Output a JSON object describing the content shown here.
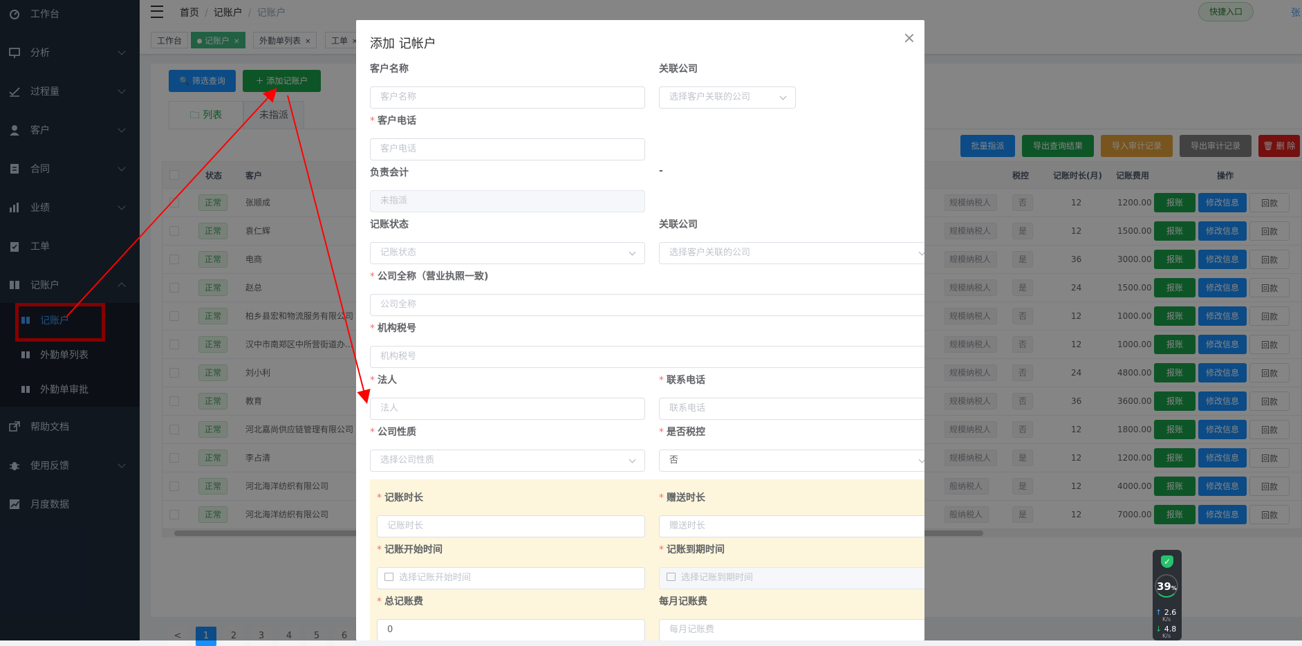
{
  "sidebar": {
    "items": [
      {
        "label": "工作台",
        "icon": "dashboard-icon"
      },
      {
        "label": "分析",
        "icon": "chart-icon"
      },
      {
        "label": "过程量",
        "icon": "process-icon"
      },
      {
        "label": "客户",
        "icon": "user-icon"
      },
      {
        "label": "合同",
        "icon": "contract-icon"
      },
      {
        "label": "业绩",
        "icon": "bar-chart-icon"
      },
      {
        "label": "工单",
        "icon": "clipboard-icon"
      },
      {
        "label": "记账户",
        "icon": "book-icon"
      },
      {
        "label": "帮助文档",
        "icon": "external-link-icon"
      },
      {
        "label": "使用反馈",
        "icon": "bug-icon"
      },
      {
        "label": "月度数据",
        "icon": "trend-icon"
      }
    ],
    "subitems": [
      "记账户",
      "外勤单列表",
      "外勤单审批"
    ]
  },
  "topbar": {
    "breadcrumb": [
      "首页",
      "记账户",
      "记账户"
    ],
    "quick_entry": "快捷入口",
    "username": "张"
  },
  "tags": [
    {
      "label": "工作台"
    },
    {
      "label": "记账户"
    },
    {
      "label": "外勤单列表"
    },
    {
      "label": "工单"
    }
  ],
  "toolbar": {
    "filter": "筛选查询",
    "add": "添加记账户",
    "batch_assign": "批量指派",
    "export_result": "导出查询结果",
    "import_audit": "导入审计记录",
    "export_audit": "导出审计记录",
    "delete": "删 除"
  },
  "tabs": [
    "列表",
    "未指派"
  ],
  "table": {
    "headers": {
      "status": "状态",
      "customer": "客户",
      "tax_control": "税控",
      "duration": "记账时长(月)",
      "fee": "记账费用",
      "actions": "操作"
    },
    "rows": [
      {
        "status": "正常",
        "customer": "张顺成",
        "taxpayer": "规模纳税人",
        "tax": "否",
        "months": "12",
        "fee": "1200.00"
      },
      {
        "status": "正常",
        "customer": "袁仁辉",
        "taxpayer": "规模纳税人",
        "tax": "是",
        "months": "12",
        "fee": "1500.00"
      },
      {
        "status": "正常",
        "customer": "电商",
        "taxpayer": "规模纳税人",
        "tax": "是",
        "months": "36",
        "fee": "3000.00"
      },
      {
        "status": "正常",
        "customer": "赵总",
        "taxpayer": "规模纳税人",
        "tax": "是",
        "months": "24",
        "fee": "1500.00"
      },
      {
        "status": "正常",
        "customer": "柏乡县宏和物流服务有限公司",
        "taxpayer": "规模纳税人",
        "tax": "否",
        "months": "12",
        "fee": "1000.00"
      },
      {
        "status": "正常",
        "customer": "汉中市南郑区中所营街道办...",
        "taxpayer": "规模纳税人",
        "tax": "否",
        "months": "12",
        "fee": "1000.00"
      },
      {
        "status": "正常",
        "customer": "刘小利",
        "taxpayer": "规模纳税人",
        "tax": "否",
        "months": "24",
        "fee": "4800.00"
      },
      {
        "status": "正常",
        "customer": "教育",
        "taxpayer": "规模纳税人",
        "tax": "否",
        "months": "36",
        "fee": "3600.00"
      },
      {
        "status": "正常",
        "customer": "河北嘉尚供应链管理有限公司",
        "taxpayer": "规模纳税人",
        "tax": "否",
        "months": "12",
        "fee": "1800.00"
      },
      {
        "status": "正常",
        "customer": "李占清",
        "taxpayer": "规模纳税人",
        "tax": "是",
        "months": "12",
        "fee": "1200.00"
      },
      {
        "status": "正常",
        "customer": "河北海洋纺织有限公司",
        "taxpayer": "般纳税人",
        "tax": "是",
        "months": "12",
        "fee": "4000.00"
      },
      {
        "status": "正常",
        "customer": "河北海洋纺织有限公司",
        "taxpayer": "般纳税人",
        "tax": "是",
        "months": "12",
        "fee": "7000.00"
      }
    ],
    "actions": {
      "report": "报账",
      "edit": "修改信息",
      "refund": "回款"
    }
  },
  "pagination": [
    "<",
    "1",
    "2",
    "3",
    "4",
    "5",
    "6"
  ],
  "net_widget": {
    "percent": "39",
    "percent_unit": "%",
    "up": "2.6",
    "down": "4.8",
    "unit": "K/s"
  },
  "dialog": {
    "title": "添加 记帐户",
    "labels": {
      "customer_name": "客户名称",
      "linked_company_1": "关联公司",
      "customer_phone": "客户电话",
      "accountant": "负责会计",
      "dash": "-",
      "account_status": "记账状态",
      "linked_company_2": "关联公司",
      "company_full": "公司全称（营业执照一致)",
      "tax_no": "机构税号",
      "legal": "法人",
      "contact_phone": "联系电话",
      "company_nature": "公司性质",
      "tax_control": "是否税控",
      "duration": "记账时长",
      "gift_duration": "赠送时长",
      "start_time": "记账开始时间",
      "end_time": "记账到期时间",
      "total_fee": "总记账费",
      "monthly_fee": "每月记账费"
    },
    "placeholders": {
      "customer_name": "客户名称",
      "linked_company_1": "选择客户关联的公司",
      "customer_phone": "客户电话",
      "accountant": "未指派",
      "account_status": "记账状态",
      "linked_company_2": "选择客户关联的公司",
      "company_full": "公司全称",
      "tax_no": "机构税号",
      "legal": "法人",
      "contact_phone": "联系电话",
      "company_nature": "选择公司性质",
      "duration": "记账时长",
      "gift_duration": "赠送时长",
      "start_time": "选择记账开始时间",
      "end_time": "选择记账到期时间",
      "monthly_fee": "每月记账费"
    },
    "values": {
      "tax_control": "否",
      "total_fee": "0"
    }
  },
  "colors": {
    "sidebar_bg": "#1f2d3d",
    "primary": "#409eff",
    "success": "#1aa34a",
    "warning": "#e6a23c",
    "danger": "#e02020",
    "annotation": "#ff0000"
  }
}
